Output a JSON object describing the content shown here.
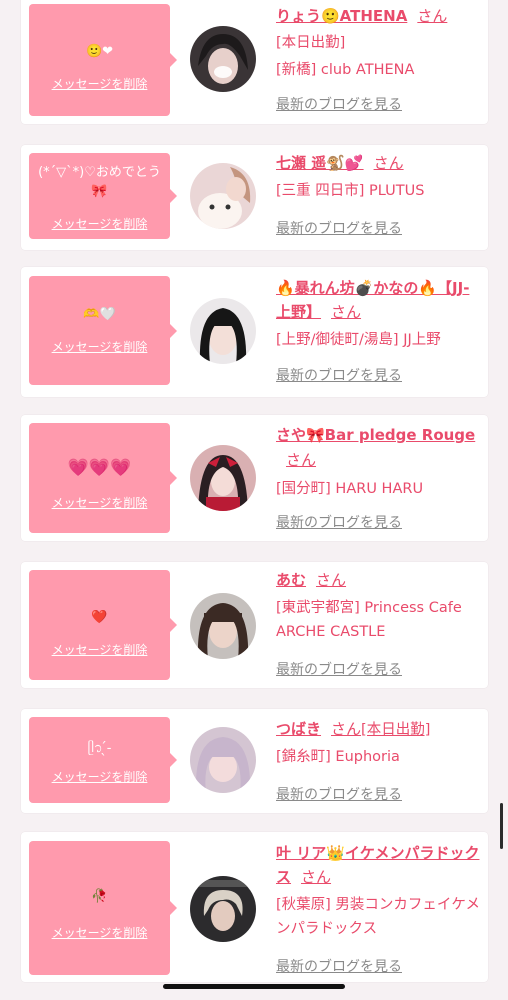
{
  "entries": [
    {
      "message": "🙂❤",
      "delete_label": "メッセージを削除",
      "name": "りょう🙂ATHENA",
      "honorific": "さん",
      "status": "[本日出勤]",
      "shop": "[新橋] club ATHENA",
      "blog_label": "最新のブログを見る"
    },
    {
      "message": "(*´▽`*)♡おめでとう🎀",
      "delete_label": "メッセージを削除",
      "name": "七瀬 遥🐒💕",
      "honorific": "さん",
      "status": "",
      "shop": "[三重 四日市] PLUTUS",
      "blog_label": "最新のブログを見る"
    },
    {
      "message": "🫶🤍",
      "delete_label": "メッセージを削除",
      "name": "🔥暴れん坊💣かなの🔥【JJ-上野】",
      "honorific": "さん",
      "status": "",
      "shop": "[上野/御徒町/湯島] JJ上野",
      "blog_label": "最新のブログを見る"
    },
    {
      "message": "💗💗💗",
      "delete_label": "メッセージを削除",
      "name": "さや🎀Bar pledge Rouge",
      "honorific": "さん",
      "status": "",
      "shop": "[国分町] HARU HARU",
      "blog_label": "最新のブログを見る"
    },
    {
      "message": "❤️",
      "delete_label": "メッセージを削除",
      "name": "あむ",
      "honorific": "さん",
      "status": "",
      "shop": "[東武宇都宮] Princess Cafe ARCHE CASTLE",
      "blog_label": "最新のブログを見る"
    },
    {
      "message": "ᥫ᭡ ̖́-",
      "delete_label": "メッセージを削除",
      "name": "つばき",
      "honorific": "さん",
      "status": "[本日出勤]",
      "shop": "[錦糸町] Euphoria",
      "blog_label": "最新のブログを見る"
    },
    {
      "message": "🥀",
      "delete_label": "メッセージを削除",
      "name": "叶 リア👑イケメンパラドックス",
      "honorific": "さん",
      "status": "",
      "shop": "[秋葉原] 男装コンカフェイケメンパラドックス",
      "blog_label": "最新のブログを見る"
    }
  ]
}
